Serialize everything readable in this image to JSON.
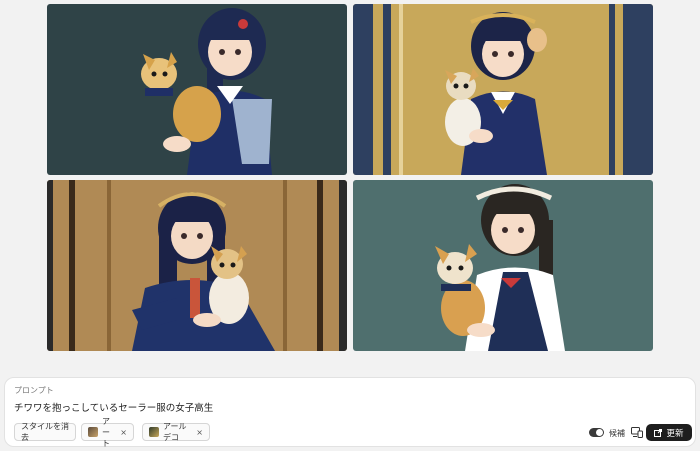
{
  "images": [
    {
      "name": "generated-image-1",
      "bg": "#2f4347",
      "accent": "#243a6b"
    },
    {
      "name": "generated-image-2",
      "bg": "#c8a85a",
      "accent": "#243a6b"
    },
    {
      "name": "generated-image-3",
      "bg": "#b08a55",
      "accent": "#243a6b"
    },
    {
      "name": "generated-image-4",
      "bg": "#4f6f6e",
      "accent": "#1f2f57"
    }
  ],
  "prompt_panel": {
    "label": "プロンプト",
    "text": "チワワを抱っこしているセーラー服の女子高生",
    "clear_style": "スタイルを消去",
    "chips": [
      {
        "label": "アート",
        "remove": "×"
      },
      {
        "label": "アールデコ",
        "remove": "×"
      }
    ],
    "candidates_label": "候補",
    "refresh_label": "更新"
  },
  "colors": {
    "panel_bg": "#ffffff",
    "page_bg": "#f2f2f2",
    "button_dark": "#1e1e1e",
    "toggle_on": "#3a3a3a"
  },
  "icons": [
    "device-icon",
    "refresh-icon"
  ]
}
